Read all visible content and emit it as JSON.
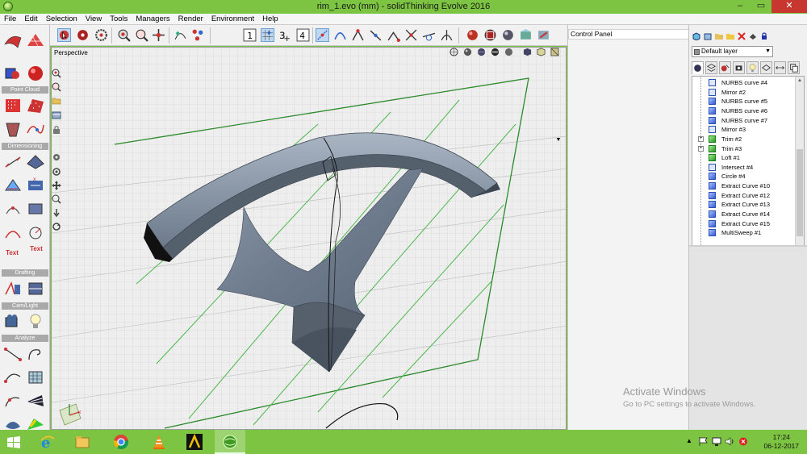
{
  "window": {
    "title": "rim_1.evo (mm) - solidThinking Evolve 2016",
    "minimize_glyph": "–",
    "maximize_glyph": "▭",
    "close_glyph": "✕"
  },
  "menu": [
    "File",
    "Edit",
    "Selection",
    "View",
    "Tools",
    "Managers",
    "Render",
    "Environment",
    "Help"
  ],
  "toolbar": {
    "layout_buttons": [
      "1",
      "4"
    ]
  },
  "palette": {
    "sections": [
      "Point Cloud",
      "Dimensioning",
      "Drafting",
      "Cam/Light",
      "Analyze"
    ],
    "text_tools": [
      "Text",
      "Text"
    ]
  },
  "viewport": {
    "label": "Perspective"
  },
  "control_panel": {
    "title": "Control Panel"
  },
  "browser": {
    "layer": "Default layer",
    "tree": [
      {
        "label": "NURBS curve #4",
        "icon": "curve-hollow-icon",
        "expand": ""
      },
      {
        "label": "Mirror #2",
        "icon": "mirror-icon",
        "expand": ""
      },
      {
        "label": "NURBS curve #5",
        "icon": "curve-icon",
        "expand": ""
      },
      {
        "label": "NURBS curve #6",
        "icon": "curve-icon",
        "expand": ""
      },
      {
        "label": "NURBS curve #7",
        "icon": "curve-icon",
        "expand": ""
      },
      {
        "label": "Mirror #3",
        "icon": "mirror-icon",
        "expand": ""
      },
      {
        "label": "Trim #2",
        "icon": "trim-icon",
        "expand": "+"
      },
      {
        "label": "Trim #3",
        "icon": "trim-icon",
        "expand": "+"
      },
      {
        "label": "Loft #1",
        "icon": "loft-icon",
        "expand": ""
      },
      {
        "label": "Intersect #4",
        "icon": "intersect-icon",
        "expand": ""
      },
      {
        "label": "Circle #4",
        "icon": "circle-icon",
        "expand": ""
      },
      {
        "label": "Extract Curve #10",
        "icon": "extract-icon",
        "expand": ""
      },
      {
        "label": "Extract Curve #12",
        "icon": "extract-icon",
        "expand": ""
      },
      {
        "label": "Extract Curve #13",
        "icon": "extract-icon",
        "expand": ""
      },
      {
        "label": "Extract Curve #14",
        "icon": "extract-icon",
        "expand": ""
      },
      {
        "label": "Extract Curve #15",
        "icon": "extract-icon",
        "expand": ""
      },
      {
        "label": "MultiSweep #1",
        "icon": "sweep-icon",
        "expand": ""
      }
    ]
  },
  "watermark": {
    "line1": "Activate Windows",
    "line2": "Go to PC settings to activate Windows."
  },
  "taskbar": {
    "apps": [
      "ie-icon",
      "file-explorer-icon",
      "chrome-icon",
      "vlc-icon",
      "archicad-icon",
      "evolve-icon"
    ],
    "time": "17:24",
    "date": "06-12-2017"
  }
}
